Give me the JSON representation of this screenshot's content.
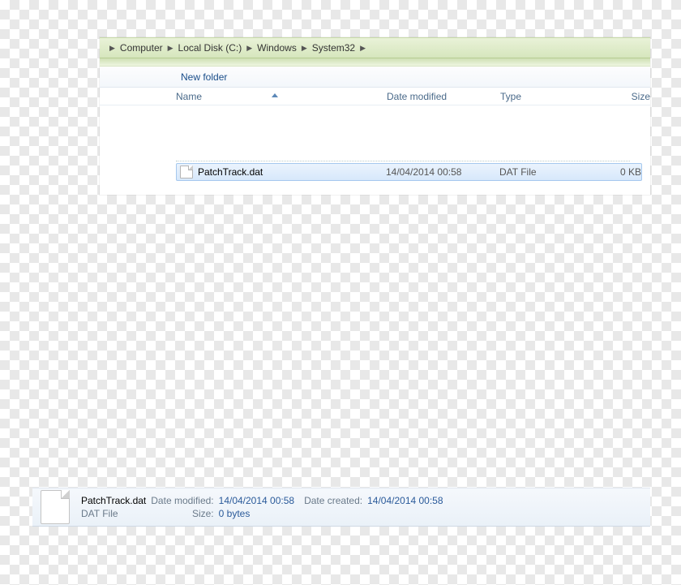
{
  "breadcrumb": {
    "items": [
      "Computer",
      "Local Disk (C:)",
      "Windows",
      "System32"
    ]
  },
  "toolbar": {
    "new_folder": "New folder"
  },
  "columns": {
    "name": "Name",
    "date": "Date modified",
    "type": "Type",
    "size": "Size"
  },
  "file": {
    "name": "PatchTrack.dat",
    "date": "14/04/2014 00:58",
    "type": "DAT File",
    "size": "0 KB"
  },
  "details": {
    "name": "PatchTrack.dat",
    "subtype": "DAT File",
    "mod_label": "Date modified:",
    "mod_val": "14/04/2014 00:58",
    "size_label": "Size:",
    "size_val": "0 bytes",
    "created_label": "Date created:",
    "created_val": "14/04/2014 00:58"
  }
}
